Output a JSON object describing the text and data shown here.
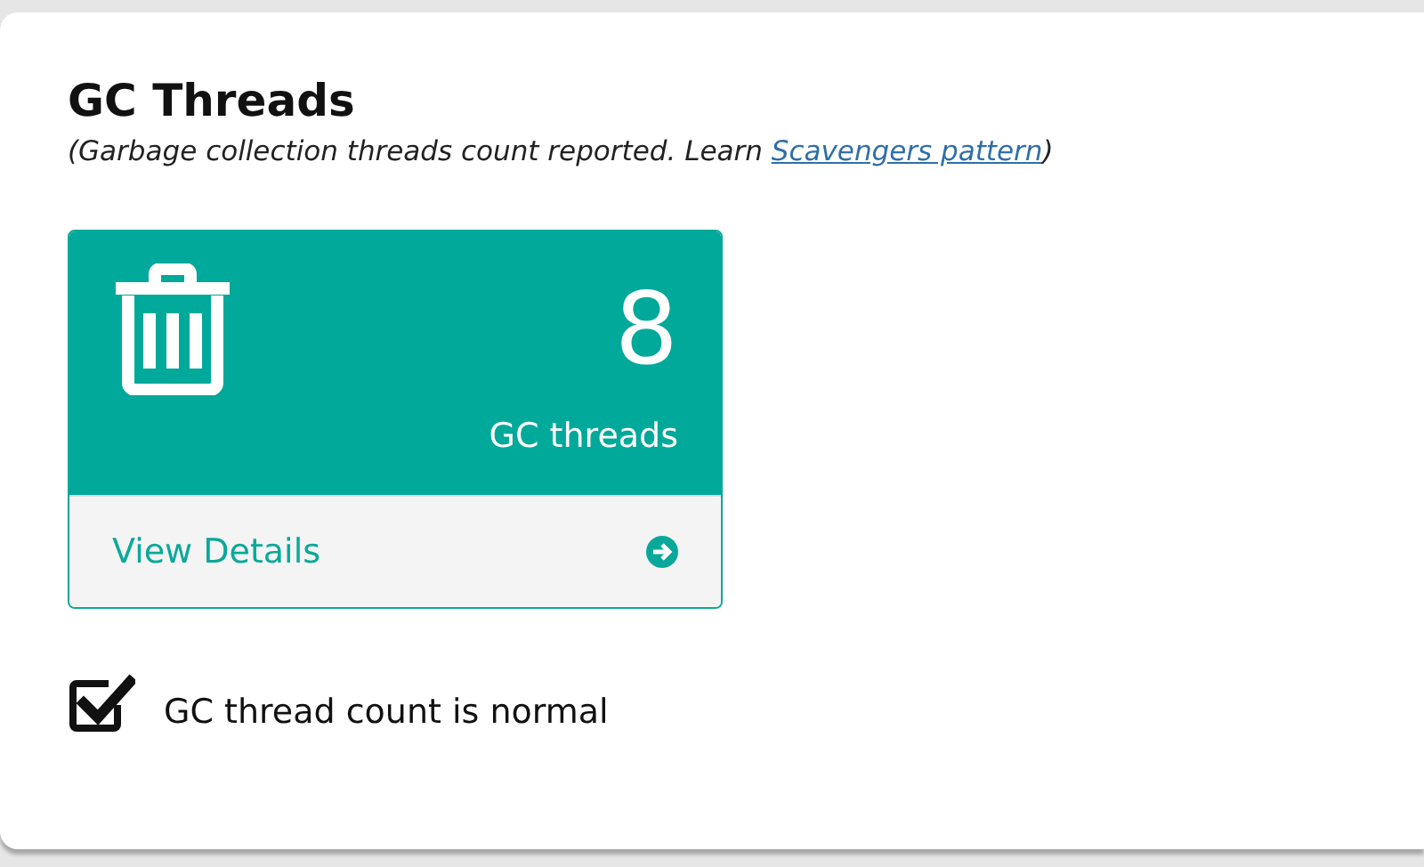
{
  "title": "GC Threads",
  "subtitle": {
    "before": "(Garbage collection threads count reported. Learn ",
    "link": "Scavengers pattern",
    "after": ")"
  },
  "tile": {
    "value": "8",
    "label": "GC threads",
    "action": "View Details"
  },
  "status": {
    "checked": true,
    "text": "GC thread count is normal"
  }
}
